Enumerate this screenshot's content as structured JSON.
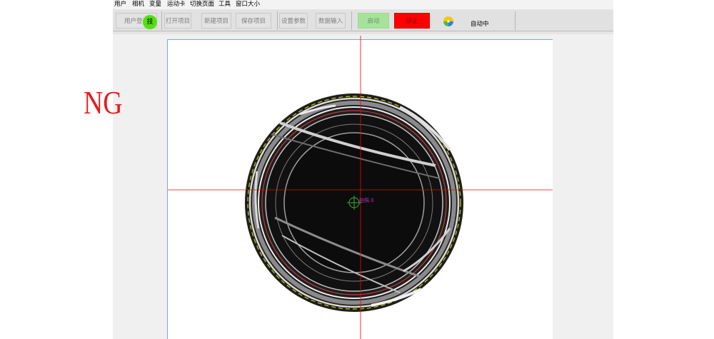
{
  "menu": {
    "items": [
      {
        "label": "用户"
      },
      {
        "label": "相机"
      },
      {
        "label": "变量"
      },
      {
        "label": "运动卡"
      },
      {
        "label": "切换页面"
      },
      {
        "label": "工具"
      },
      {
        "label": "窗口大小"
      }
    ]
  },
  "toolbar": {
    "user_login_label": "用户登录",
    "tech_badge": "技",
    "open_project_label": "打开项目",
    "new_project_label": "新建项目",
    "save_project_label": "保存项目",
    "set_params_label": "设置参数",
    "data_input_label": "数据输入",
    "start_label": "启动",
    "stop_label": "停止",
    "status_text": "自动中",
    "status_icon": "pinwheel-icon"
  },
  "result": {
    "label": "NG",
    "color": "#e61d1d"
  },
  "overlay": {
    "coord_label": "拍照.0",
    "crosshair_color": "#ff0000",
    "center_marker_color": "#2fb52f"
  },
  "colors": {
    "start_button": "#a6e39a",
    "stop_button": "#ff0000",
    "tech_badge": "#53e010",
    "frame_border": "#7aa6e0"
  }
}
